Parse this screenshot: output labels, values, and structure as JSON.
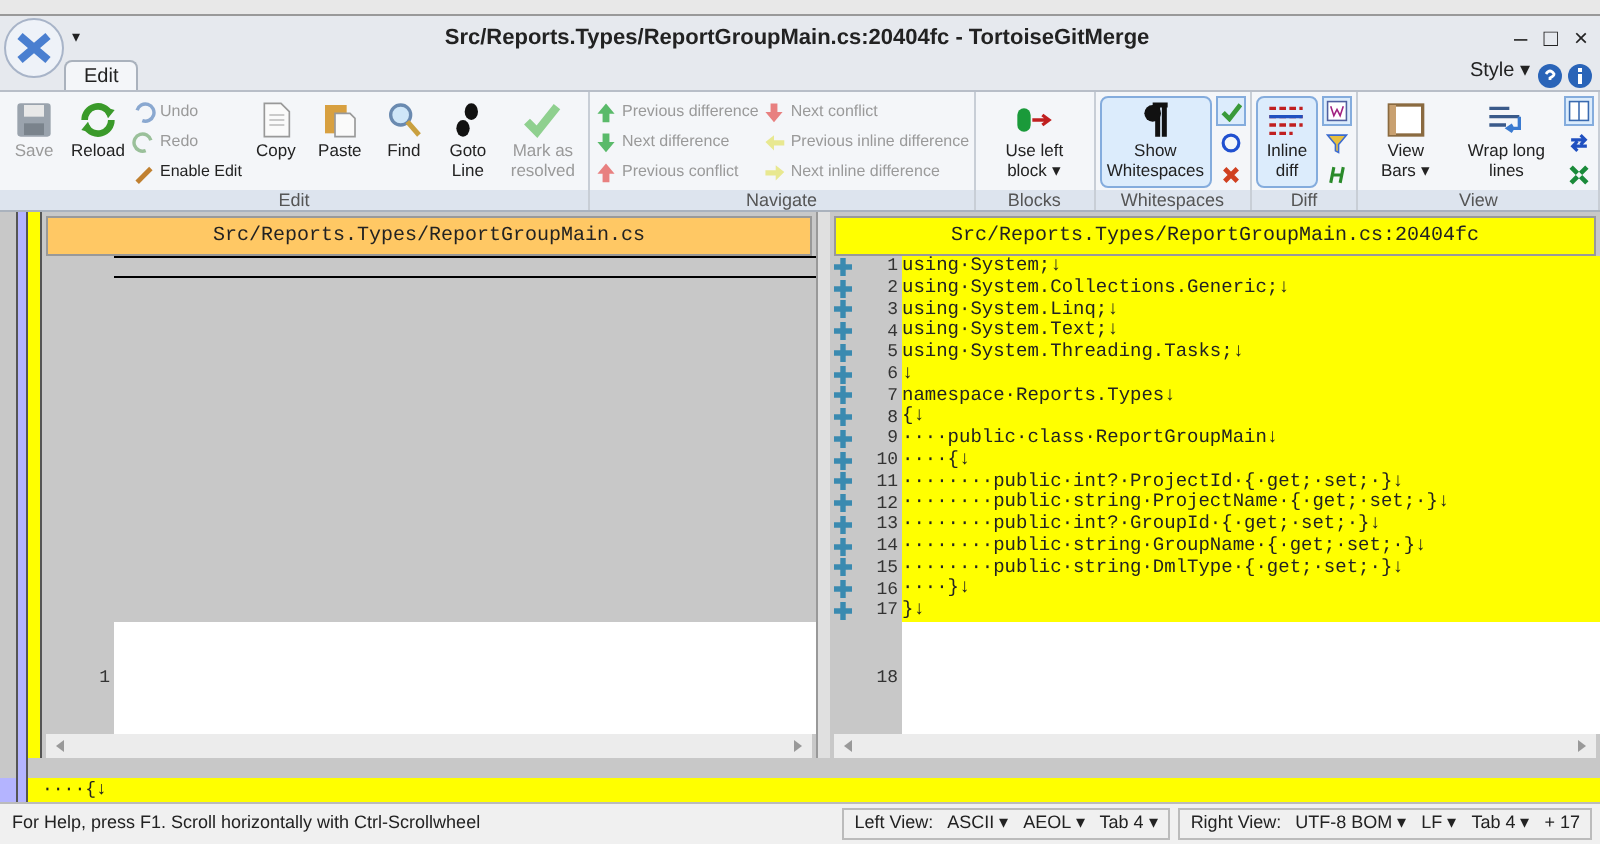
{
  "window": {
    "title": "Src/Reports.Types/ReportGroupMain.cs:20404fc - TortoiseGitMerge",
    "quick_access": "▾",
    "controls": [
      "–",
      "□",
      "×"
    ]
  },
  "tabs": [
    {
      "label": "Edit",
      "selected": true
    }
  ],
  "style_menu": "Style ▾",
  "ribbon": [
    {
      "label": "Edit",
      "items": [
        {
          "kind": "large",
          "label": "Save",
          "disabled": true
        },
        {
          "kind": "large",
          "label": "Reload",
          "disabled": false
        },
        {
          "kind": "stack",
          "items": [
            {
              "label": "Undo",
              "disabled": true
            },
            {
              "label": "Redo",
              "disabled": true
            },
            {
              "label": "Enable Edit",
              "disabled": false
            }
          ]
        },
        {
          "kind": "large",
          "label": "Copy",
          "disabled": false
        },
        {
          "kind": "large",
          "label": "Paste",
          "disabled": false
        },
        {
          "kind": "large",
          "label": "Find",
          "disabled": false
        },
        {
          "kind": "large",
          "label": "Goto Line",
          "disabled": false
        },
        {
          "kind": "large",
          "label": "Mark as resolved",
          "disabled": true
        }
      ]
    },
    {
      "label": "Navigate",
      "items": [
        {
          "kind": "stack",
          "items": [
            {
              "label": "Previous difference",
              "disabled": true
            },
            {
              "label": "Next difference",
              "disabled": true
            },
            {
              "label": "Previous conflict",
              "disabled": true
            }
          ]
        },
        {
          "kind": "stack",
          "items": [
            {
              "label": "Next conflict",
              "disabled": true
            },
            {
              "label": "Previous inline difference",
              "disabled": true
            },
            {
              "label": "Next inline difference",
              "disabled": true
            }
          ]
        }
      ]
    },
    {
      "label": "Blocks",
      "items": [
        {
          "kind": "large",
          "label": "Use left block ▾",
          "disabled": false
        }
      ]
    },
    {
      "label": "Whitespaces",
      "items": [
        {
          "kind": "large",
          "label": "Show Whitespaces",
          "disabled": false,
          "selected": true
        },
        {
          "kind": "icons",
          "items": [
            {
              "selected": true
            },
            {
              "selected": false
            },
            {
              "selected": false
            }
          ]
        }
      ]
    },
    {
      "label": "Diff",
      "items": [
        {
          "kind": "large",
          "label": "Inline diff",
          "disabled": false,
          "selected": true
        },
        {
          "kind": "icons",
          "items": [
            {
              "selected": true
            },
            {
              "selected": false
            },
            {
              "selected": false
            }
          ]
        }
      ]
    },
    {
      "label": "View",
      "items": [
        {
          "kind": "large",
          "label": "View Bars ▾",
          "disabled": false
        },
        {
          "kind": "large",
          "label": "Wrap long lines",
          "disabled": false
        },
        {
          "kind": "icons",
          "items": [
            {
              "selected": true
            },
            {
              "selected": false
            },
            {
              "selected": false
            }
          ]
        }
      ]
    }
  ],
  "left_pane": {
    "title": "Src/Reports.Types/ReportGroupMain.cs",
    "lines": [
      {
        "kind": "missing"
      },
      {
        "kind": "missing"
      },
      {
        "kind": "missing"
      },
      {
        "kind": "missing"
      },
      {
        "kind": "missing"
      },
      {
        "kind": "missing"
      },
      {
        "kind": "missing"
      },
      {
        "kind": "missing"
      },
      {
        "kind": "missing"
      },
      {
        "kind": "missing"
      },
      {
        "kind": "missing"
      },
      {
        "kind": "missing"
      },
      {
        "kind": "missing"
      },
      {
        "kind": "missing"
      },
      {
        "kind": "missing"
      },
      {
        "kind": "missing"
      },
      {
        "kind": "missing"
      },
      {
        "kind": "normal",
        "number": "1"
      }
    ]
  },
  "right_pane": {
    "title": "Src/Reports.Types/ReportGroupMain.cs:20404fc",
    "lines": [
      {
        "kind": "added",
        "number": "1",
        "text": "using·System;↓"
      },
      {
        "kind": "added",
        "number": "2",
        "text": "using·System.Collections.Generic;↓"
      },
      {
        "kind": "added",
        "number": "3",
        "text": "using·System.Linq;↓"
      },
      {
        "kind": "added",
        "number": "4",
        "text": "using·System.Text;↓"
      },
      {
        "kind": "added",
        "number": "5",
        "text": "using·System.Threading.Tasks;↓"
      },
      {
        "kind": "added",
        "number": "6",
        "text": "↓"
      },
      {
        "kind": "added",
        "number": "7",
        "text": "namespace·Reports.Types↓"
      },
      {
        "kind": "added",
        "number": "8",
        "text": "{↓"
      },
      {
        "kind": "added",
        "number": "9",
        "text": "····public·class·ReportGroupMain↓"
      },
      {
        "kind": "added",
        "number": "10",
        "text": "····{↓"
      },
      {
        "kind": "added",
        "number": "11",
        "text": "········public·int?·ProjectId·{·get;·set;·}↓"
      },
      {
        "kind": "added",
        "number": "12",
        "text": "········public·string·ProjectName·{·get;·set;·}↓"
      },
      {
        "kind": "added",
        "number": "13",
        "text": "········public·int?·GroupId·{·get;·set;·}↓"
      },
      {
        "kind": "added",
        "number": "14",
        "text": "········public·string·GroupName·{·get;·set;·}↓"
      },
      {
        "kind": "added",
        "number": "15",
        "text": "········public·string·DmlType·{·get;·set;·}↓"
      },
      {
        "kind": "added",
        "number": "16",
        "text": "····}↓"
      },
      {
        "kind": "added",
        "number": "17",
        "text": "}↓"
      },
      {
        "kind": "normal",
        "number": "18"
      }
    ]
  },
  "line_detail": "····{↓",
  "status_bar": {
    "help": "For Help, press F1. Scroll horizontally with Ctrl-Scrollwheel",
    "left_view": {
      "label": "Left View:",
      "items": [
        "ASCII ▾",
        "AEOL ▾",
        "Tab 4 ▾"
      ]
    },
    "right_view": {
      "label": "Right View:",
      "items": [
        "UTF-8 BOM ▾",
        "LF ▾",
        "Tab 4 ▾",
        "+ 17"
      ]
    }
  }
}
